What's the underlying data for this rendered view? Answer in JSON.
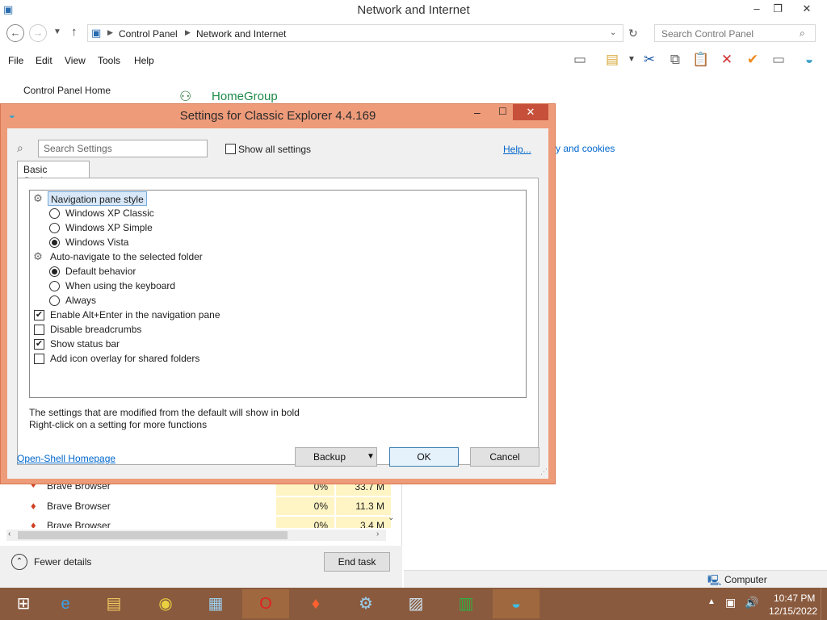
{
  "explorer": {
    "title": "Network and Internet",
    "window_controls": [
      "–",
      "❐",
      "✕"
    ],
    "breadcrumb": [
      "Control Panel",
      "Network and Internet"
    ],
    "search_placeholder": "Search Control Panel",
    "menu": [
      "File",
      "Edit",
      "View",
      "Tools",
      "Help"
    ],
    "sidebar_home": "Control Panel Home",
    "homegroup": "HomeGroup",
    "partial_link": "y and cookies",
    "status_computer": "Computer"
  },
  "dialog": {
    "title": "Settings for Classic Explorer 4.4.169",
    "search_placeholder": "Search Settings",
    "show_all": "Show all settings",
    "help": "Help...",
    "tab": "Basic Settings",
    "items": {
      "nav_style": "Navigation pane style",
      "xp_classic": "Windows XP Classic",
      "xp_simple": "Windows XP Simple",
      "vista": "Windows Vista",
      "auto_nav": "Auto-navigate to the selected folder",
      "default_behavior": "Default behavior",
      "keyboard": "When using the keyboard",
      "always": "Always",
      "alt_enter": "Enable Alt+Enter in the navigation pane",
      "disable_breadcrumbs": "Disable breadcrumbs",
      "show_status": "Show status bar",
      "icon_overlay": "Add icon overlay for shared folders"
    },
    "info_line1": "The settings that are modified from the default will show in bold",
    "info_line2": "Right-click on a setting for more functions",
    "homepage_link": "Open-Shell Homepage",
    "backup": "Backup",
    "ok": "OK",
    "cancel": "Cancel"
  },
  "taskmanager": {
    "rows": [
      {
        "name": "Brave Browser",
        "cpu": "0%",
        "mem": "33.7 M"
      },
      {
        "name": "Brave Browser",
        "cpu": "0%",
        "mem": "11.3 M"
      },
      {
        "name": "Brave Browser",
        "cpu": "0%",
        "mem": "3.4 M"
      }
    ],
    "fewer_details": "Fewer details",
    "end_task": "End task"
  },
  "taskbar": {
    "time": "10:47 PM",
    "date": "12/15/2022"
  },
  "colors": {
    "dialog_frame": "#ee9b7a",
    "close_button": "#c7503a",
    "taskbar": "#8a5a3e",
    "link": "#0066cc"
  }
}
